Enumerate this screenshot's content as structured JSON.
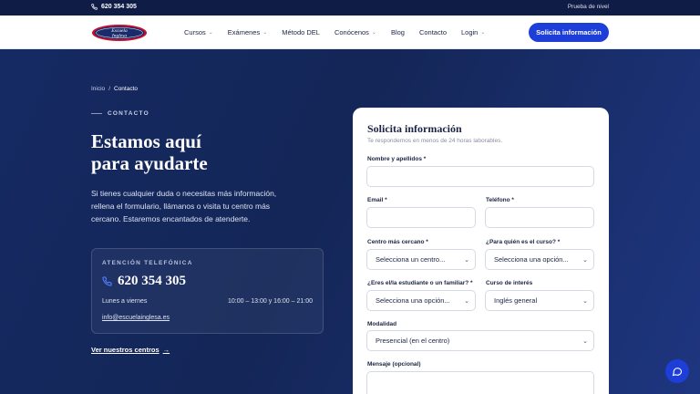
{
  "topbar": {
    "phone": "620 354 305",
    "level_test": "Prueba de nivel"
  },
  "logo": {
    "text_line1": "Escuela",
    "text_line2": "Inglesa"
  },
  "nav": {
    "items": [
      {
        "label": "Cursos",
        "has_dropdown": true
      },
      {
        "label": "Exámenes",
        "has_dropdown": true
      },
      {
        "label": "Método DEL",
        "has_dropdown": false
      },
      {
        "label": "Conócenos",
        "has_dropdown": true
      },
      {
        "label": "Blog",
        "has_dropdown": false
      },
      {
        "label": "Contacto",
        "has_dropdown": false
      },
      {
        "label": "Login",
        "has_dropdown": true
      }
    ],
    "cta": "Solicita información"
  },
  "breadcrumb": {
    "home": "Inicio",
    "separator": "/",
    "current": "Contacto"
  },
  "hero": {
    "eyebrow": "CONTACTO",
    "headline_line1": "Estamos aquí",
    "headline_line2": "para ayudarte",
    "intro": "Si tienes cualquier duda o necesitas más información, rellena el formulario, llámanos o visita tu centro más cercano. Estaremos encantados de atenderte."
  },
  "phone_card": {
    "label": "ATENCIÓN TELEFÓNICA",
    "number": "620 354 305",
    "days": "Lunes a viernes",
    "hours": "10:00 – 13:00 y 16:00 – 21:00",
    "email": "info@escuelainglesa.es"
  },
  "centers_link": "Ver nuestros centros",
  "form": {
    "title": "Solicita información",
    "subtitle": "Te respondemos en menos de 24 horas laborables.",
    "name_label": "Nombre y apellidos *",
    "email_label": "Email *",
    "phone_label": "Teléfono *",
    "center_label": "Centro más cercano *",
    "center_value": "Selecciona un centro...",
    "for_whom_label": "¿Para quién es el curso? *",
    "for_whom_value": "Selecciona una opción...",
    "relation_label": "¿Eres el/la estudiante o un familiar? *",
    "relation_value": "Selecciona una opción...",
    "course_label": "Curso de interés",
    "course_value": "Inglés general",
    "modality_label": "Modalidad",
    "modality_value": "Presencial (en el centro)",
    "message_label": "Mensaje (opcional)"
  },
  "colors": {
    "accent": "#1d3fd8",
    "dark_navy": "#0f1c46",
    "hero_bg": "#16275a",
    "logo_red": "#c8102e"
  },
  "icons": {
    "phone": "phone-icon",
    "arrow": "arrow-right-icon",
    "chat": "chat-icon"
  }
}
